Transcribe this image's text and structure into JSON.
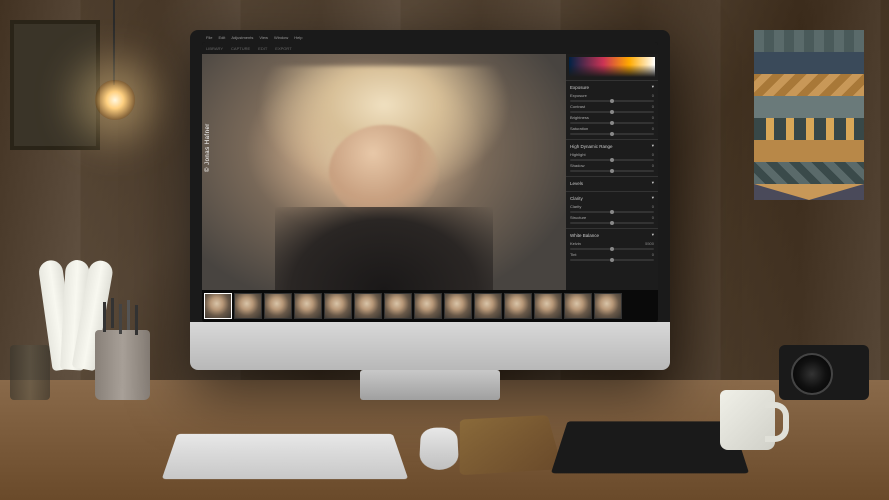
{
  "credit": "© Jonas Hafner",
  "menubar": {
    "items": [
      "File",
      "Edit",
      "Adjustments",
      "View",
      "Window",
      "Help"
    ]
  },
  "toolbar": {
    "items": [
      "LIBRARY",
      "CAPTURE",
      "EDIT",
      "EXPORT"
    ]
  },
  "panels": {
    "exposure": {
      "title": "Exposure",
      "rows": [
        {
          "label": "Exposure",
          "value": "0"
        },
        {
          "label": "Contrast",
          "value": "0"
        },
        {
          "label": "Brightness",
          "value": "0"
        },
        {
          "label": "Saturation",
          "value": "0"
        }
      ]
    },
    "hdr": {
      "title": "High Dynamic Range",
      "rows": [
        {
          "label": "Highlight",
          "value": "0"
        },
        {
          "label": "Shadow",
          "value": "0"
        }
      ]
    },
    "levels": {
      "title": "Levels"
    },
    "clarity": {
      "title": "Clarity",
      "rows": [
        {
          "label": "Clarity",
          "value": "0"
        },
        {
          "label": "Structure",
          "value": "0"
        }
      ]
    },
    "wb": {
      "title": "White Balance",
      "rows": [
        {
          "label": "Kelvin",
          "value": "5500"
        },
        {
          "label": "Tint",
          "value": "0"
        }
      ]
    }
  },
  "filmstrip": {
    "count": 14,
    "selected": 0
  }
}
